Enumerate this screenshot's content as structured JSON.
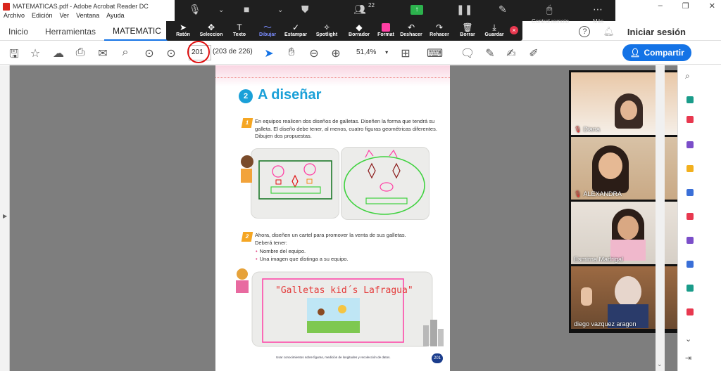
{
  "window": {
    "title": "MATEMATICAS.pdf - Adobe Acrobat Reader DC",
    "min": "–",
    "max": "❐",
    "close": "✕"
  },
  "menu": [
    "Archivo",
    "Edición",
    "Ver",
    "Ventana",
    "Ayuda"
  ],
  "tabs": {
    "home": "Inicio",
    "tools": "Herramientas",
    "doc": "MATEMATIC",
    "help": "?",
    "login": "Iniciar sesión"
  },
  "zoom_meeting": {
    "participants_count": "22",
    "remote_control": "Control remoto",
    "more": "Más"
  },
  "annotate": {
    "tools": [
      "Ratón",
      "Seleccion",
      "Texto",
      "Dibujar",
      "Estampar",
      "Spotlight",
      "Borrador",
      "Format",
      "Deshacer",
      "Rehacer",
      "Borrar",
      "Guardar"
    ],
    "selected": "Dibujar"
  },
  "toolbar": {
    "page_value": "201",
    "page_count": "(203 de 226)",
    "zoom_value": "51,4%",
    "share_label": "Compartir"
  },
  "page": {
    "section_number": "2",
    "heading": "A diseñar",
    "step1_number": "1",
    "step1_text": "En equipos realicen dos diseños de galletas. Diseñen la forma que tendrá su galleta. El diseño debe tener, al menos, cuatro figuras geométricas diferentes. Dibujen dos propuestas.",
    "step2_number": "2",
    "step2_text": "Ahora, diseñen un cartel para promover la venta de sus galletas. Deberá tener:",
    "bullets": [
      "Nombre del equipo.",
      "Una imagen que distinga a su equipo."
    ],
    "poster_title": "\"Galletas kid´s Lafragua\"",
    "footer": "Usar conocimientos sobre figuras, medición de longitudes y recolección de datos.",
    "page_number": "201"
  },
  "participants": [
    {
      "name": "Diana",
      "muted": true
    },
    {
      "name": "ALEXANDRA",
      "muted": true
    },
    {
      "name": "Esmirna Madrigal",
      "muted": false
    },
    {
      "name": "diego vazquez aragon",
      "muted": false
    }
  ],
  "colors": {
    "accent": "#1473e6",
    "drawing_red": "#e01010",
    "annot_pink": "#ff3fa4",
    "zoom_dark": "#1f1f1f"
  }
}
